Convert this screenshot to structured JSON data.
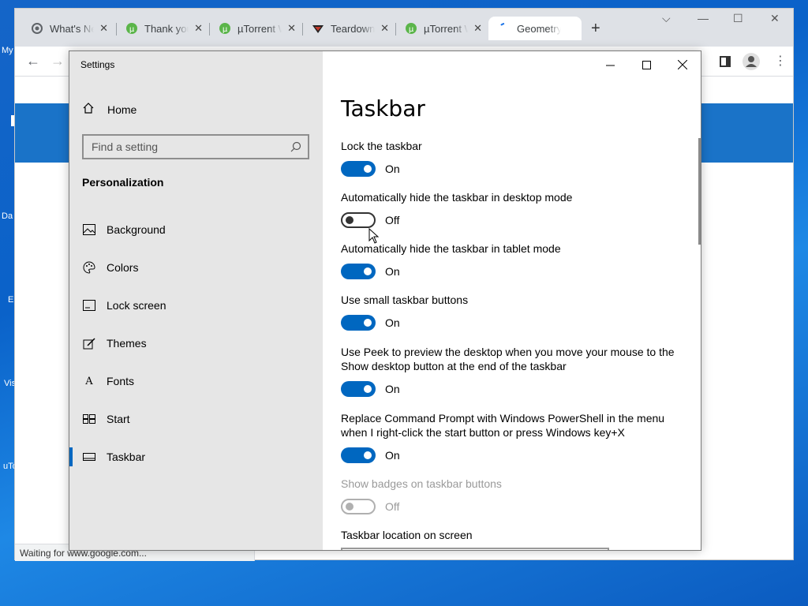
{
  "desktop": {
    "labels": [
      "My",
      "Da",
      "E",
      "Vis",
      "uTo"
    ]
  },
  "browser": {
    "tabs": [
      {
        "title": "What's Ne",
        "icon": "chrome-icon"
      },
      {
        "title": "Thank you",
        "icon": "utorrent-icon"
      },
      {
        "title": "µTorrent W",
        "icon": "utorrent-icon"
      },
      {
        "title": "Teardown",
        "icon": "teardown-icon"
      },
      {
        "title": "µTorrent W",
        "icon": "utorrent-icon"
      },
      {
        "title": "Geometry",
        "icon": "loading-icon",
        "active": true
      }
    ],
    "status": "Waiting for www.google.com..."
  },
  "settings": {
    "window_title": "Settings",
    "home_label": "Home",
    "search_placeholder": "Find a setting",
    "group_title": "Personalization",
    "nav_items": [
      {
        "label": "Background",
        "icon": "image-icon"
      },
      {
        "label": "Colors",
        "icon": "palette-icon"
      },
      {
        "label": "Lock screen",
        "icon": "lock-screen-icon"
      },
      {
        "label": "Themes",
        "icon": "brush-icon"
      },
      {
        "label": "Fonts",
        "icon": "font-icon"
      },
      {
        "label": "Start",
        "icon": "start-icon"
      },
      {
        "label": "Taskbar",
        "icon": "taskbar-icon",
        "selected": true
      }
    ],
    "page_title": "Taskbar",
    "options": [
      {
        "label": "Lock the taskbar",
        "state": "On"
      },
      {
        "label": "Automatically hide the taskbar in desktop mode",
        "state": "Off"
      },
      {
        "label": "Automatically hide the taskbar in tablet mode",
        "state": "On"
      },
      {
        "label": "Use small taskbar buttons",
        "state": "On"
      },
      {
        "label": "Use Peek to preview the desktop when you move your mouse to the Show desktop button at the end of the taskbar",
        "state": "On"
      },
      {
        "label": "Replace Command Prompt with Windows PowerShell in the menu when I right-click the start button or press Windows key+X",
        "state": "On"
      },
      {
        "label": "Show badges on taskbar buttons",
        "state": "Off",
        "disabled": true
      }
    ],
    "location_label": "Taskbar location on screen",
    "accent_color": "#0067c0"
  }
}
